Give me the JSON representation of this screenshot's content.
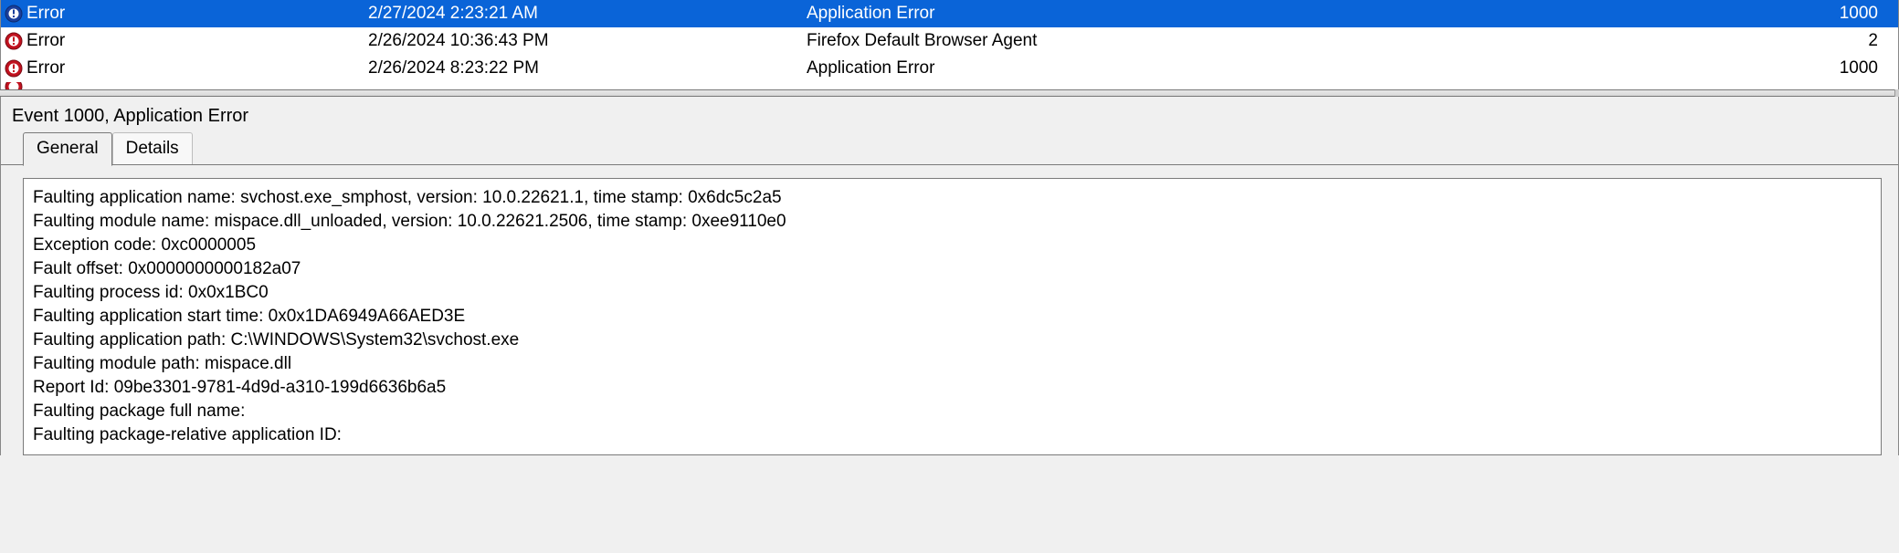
{
  "events": [
    {
      "level": "Error",
      "date": "2/27/2024 2:23:21 AM",
      "source": "Application Error",
      "id": "1000",
      "selected": true
    },
    {
      "level": "Error",
      "date": "2/26/2024 10:36:43 PM",
      "source": "Firefox Default Browser Agent",
      "id": "2",
      "selected": false
    },
    {
      "level": "Error",
      "date": "2/26/2024 8:23:22 PM",
      "source": "Application Error",
      "id": "1000",
      "selected": false
    }
  ],
  "detail": {
    "header": "Event 1000, Application Error",
    "tabs": {
      "general": "General",
      "details": "Details"
    },
    "lines": [
      "Faulting application name: svchost.exe_smphost, version: 10.0.22621.1, time stamp: 0x6dc5c2a5",
      "Faulting module name: mispace.dll_unloaded, version: 10.0.22621.2506, time stamp: 0xee9110e0",
      "Exception code: 0xc0000005",
      "Fault offset: 0x0000000000182a07",
      "Faulting process id: 0x0x1BC0",
      "Faulting application start time: 0x0x1DA6949A66AED3E",
      "Faulting application path: C:\\WINDOWS\\System32\\svchost.exe",
      "Faulting module path: mispace.dll",
      "Report Id: 09be3301-9781-4d9d-a310-199d6636b6a5",
      "Faulting package full name:",
      "Faulting package-relative application ID:"
    ]
  }
}
